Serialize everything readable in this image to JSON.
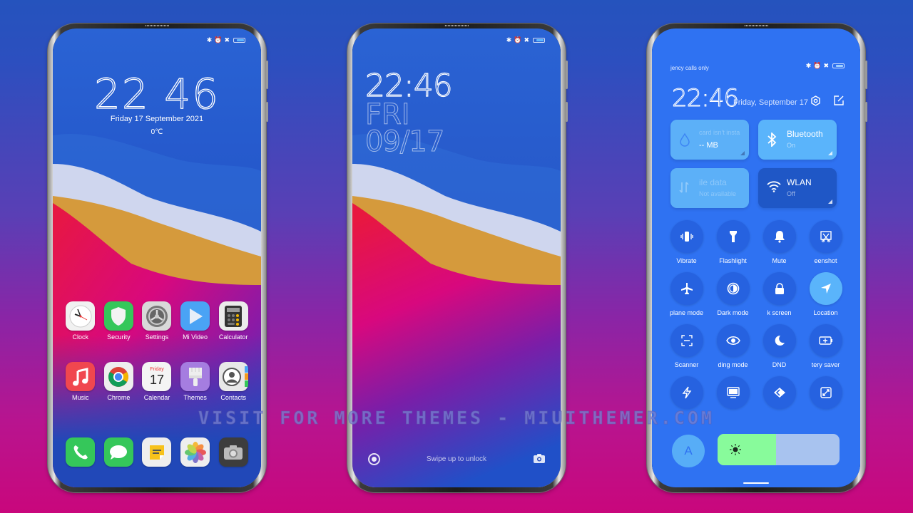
{
  "status_icons": [
    "bluetooth-icon",
    "alarm-icon",
    "no-sim-icon",
    "battery-icon"
  ],
  "home_screen": {
    "time_hours": "22",
    "time_minutes": "46",
    "date": "Friday 17 September 2021",
    "temperature": "0℃",
    "apps_row1": [
      {
        "label": "Clock",
        "icon": "clock-icon",
        "bg": "#f1f1f1"
      },
      {
        "label": "Security",
        "icon": "shield-icon",
        "bg": "#35c75a"
      },
      {
        "label": "Settings",
        "icon": "gear-icon",
        "bg": "#d9d9d9"
      },
      {
        "label": "Mi Video",
        "icon": "play-icon",
        "bg": "#4aa3f5"
      },
      {
        "label": "Calculator",
        "icon": "calculator-icon",
        "bg": "#ececec"
      }
    ],
    "apps_row2": [
      {
        "label": "Music",
        "icon": "music-note-icon",
        "bg": "#f0474f"
      },
      {
        "label": "Chrome",
        "icon": "chrome-icon",
        "bg": "#eeeeee"
      },
      {
        "label": "Calendar",
        "icon": "calendar-icon",
        "bg": "#f4f4f4",
        "day_name": "Friday",
        "day_num": "17"
      },
      {
        "label": "Themes",
        "icon": "paintbrush-icon",
        "bg": "#a57de0"
      },
      {
        "label": "Contacts",
        "icon": "contacts-icon",
        "bg": "#e8e8e8"
      }
    ],
    "dock": [
      {
        "icon": "phone-icon",
        "bg": "#35c75a"
      },
      {
        "icon": "message-icon",
        "bg": "#35c75a"
      },
      {
        "icon": "notes-icon",
        "bg": "#eeeeee"
      },
      {
        "icon": "photos-icon",
        "bg": "#eeeeee"
      },
      {
        "icon": "camera-icon",
        "bg": "#3d3d3d"
      }
    ]
  },
  "lock_screen": {
    "time": "22:46",
    "day": "FRI",
    "date": "09/17",
    "unlock_hint": "Swipe up to unlock"
  },
  "control_center": {
    "carrier": "jency calls only",
    "time": "22:46",
    "date": "Friday, September 17",
    "tiles": [
      {
        "title": "card isn't insta",
        "sub": "--  MB",
        "icon": "water-drop-icon",
        "state": "dim"
      },
      {
        "title": "Bluetooth",
        "sub": "On",
        "icon": "bluetooth-icon",
        "state": "on"
      },
      {
        "title": "ile data",
        "sub": "Not available",
        "icon": "mobile-data-icon",
        "state": "dim"
      },
      {
        "title": "WLAN",
        "sub": "Off",
        "icon": "wifi-icon",
        "state": "off"
      }
    ],
    "toggles": [
      {
        "label": "Vibrate",
        "icon": "vibrate-icon",
        "on": false
      },
      {
        "label": "Flashlight",
        "icon": "flashlight-icon",
        "on": false
      },
      {
        "label": "Mute",
        "icon": "bell-icon",
        "on": false
      },
      {
        "label": "eenshot",
        "icon": "screenshot-icon",
        "on": false
      },
      {
        "label": "plane mode",
        "icon": "airplane-icon",
        "on": false
      },
      {
        "label": "Dark mode",
        "icon": "dark-mode-icon",
        "on": false
      },
      {
        "label": "k screen",
        "icon": "lock-icon",
        "on": false
      },
      {
        "label": "Location",
        "icon": "location-arrow-icon",
        "on": true
      },
      {
        "label": "Scanner",
        "icon": "scanner-icon",
        "on": false
      },
      {
        "label": "ding mode",
        "icon": "eye-icon",
        "on": false
      },
      {
        "label": "DND",
        "icon": "moon-icon",
        "on": false
      },
      {
        "label": "tery saver",
        "icon": "battery-saver-icon",
        "on": false
      },
      {
        "label": "",
        "icon": "lightning-icon",
        "on": false
      },
      {
        "label": "",
        "icon": "cast-screen-icon",
        "on": false
      },
      {
        "label": "",
        "icon": "nearby-share-icon",
        "on": false
      },
      {
        "label": "",
        "icon": "fullscreen-icon",
        "on": false
      }
    ],
    "auto_brightness_label": "A",
    "brightness_percent": 48
  },
  "watermark": "VISIT FOR MORE THEMES - MIUITHEMER.COM"
}
